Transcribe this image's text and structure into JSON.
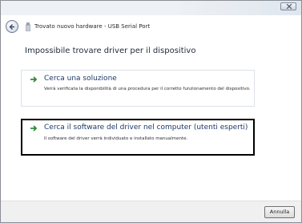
{
  "header": {
    "title": "Trovato nuovo hardware - USB Serial Port"
  },
  "page": {
    "heading": "Impossibile trovare driver per il dispositivo"
  },
  "options": [
    {
      "title": "Cerca una soluzione",
      "description": "Verrà verificata la disponibilità di una procedura per il corretto funzionamento del dispositivo."
    },
    {
      "title": "Cerca il software del driver nel computer (utenti esperti)",
      "description": "Il software del driver verrà individuato e installato manualmente."
    }
  ],
  "footer": {
    "cancel_label": "Annulla"
  },
  "icons": {
    "back": "back-arrow-icon",
    "hardware": "hardware-icon",
    "option_arrow": "green-arrow-icon",
    "close": "close-icon"
  },
  "colors": {
    "option_title": "#1b3a66",
    "option_arrow": "#2e8b3a",
    "highlight_border": "#000000"
  }
}
